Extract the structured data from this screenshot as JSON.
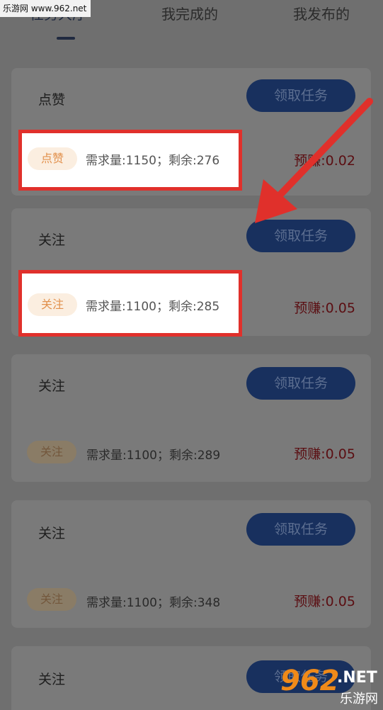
{
  "watermark": {
    "top_text": "乐游网 www.962.net",
    "logo": "962",
    "net": ".NET",
    "cn": "乐游网"
  },
  "tabs": [
    {
      "label": "任务大厅"
    },
    {
      "label": "我完成的"
    },
    {
      "label": "我发布的"
    }
  ],
  "tasks": [
    {
      "title": "点赞",
      "button": "领取任务",
      "tag": "点赞",
      "desc": "需求量:1150；剩余:276",
      "earn": "预赚:0.02",
      "highlighted": true
    },
    {
      "title": "关注",
      "button": "领取任务",
      "tag": "关注",
      "desc": "需求量:1100；剩余:285",
      "earn": "预赚:0.05",
      "highlighted": true
    },
    {
      "title": "关注",
      "button": "领取任务",
      "tag": "关注",
      "desc": "需求量:1100；剩余:289",
      "earn": "预赚:0.05",
      "highlighted": false
    },
    {
      "title": "关注",
      "button": "领取任务",
      "tag": "关注",
      "desc": "需求量:1100；剩余:348",
      "earn": "预赚:0.05",
      "highlighted": false
    },
    {
      "title": "关注",
      "button": "领取任务",
      "tag": "",
      "desc": "",
      "earn": "",
      "highlighted": false
    }
  ],
  "colors": {
    "overlay": "#6f6f6f",
    "accent": "#18305e",
    "highlight_border": "#e0302b",
    "arrow": "#e0302b",
    "earn": "#5b0e12"
  },
  "icons": [
    "arrow-annotation-icon"
  ]
}
